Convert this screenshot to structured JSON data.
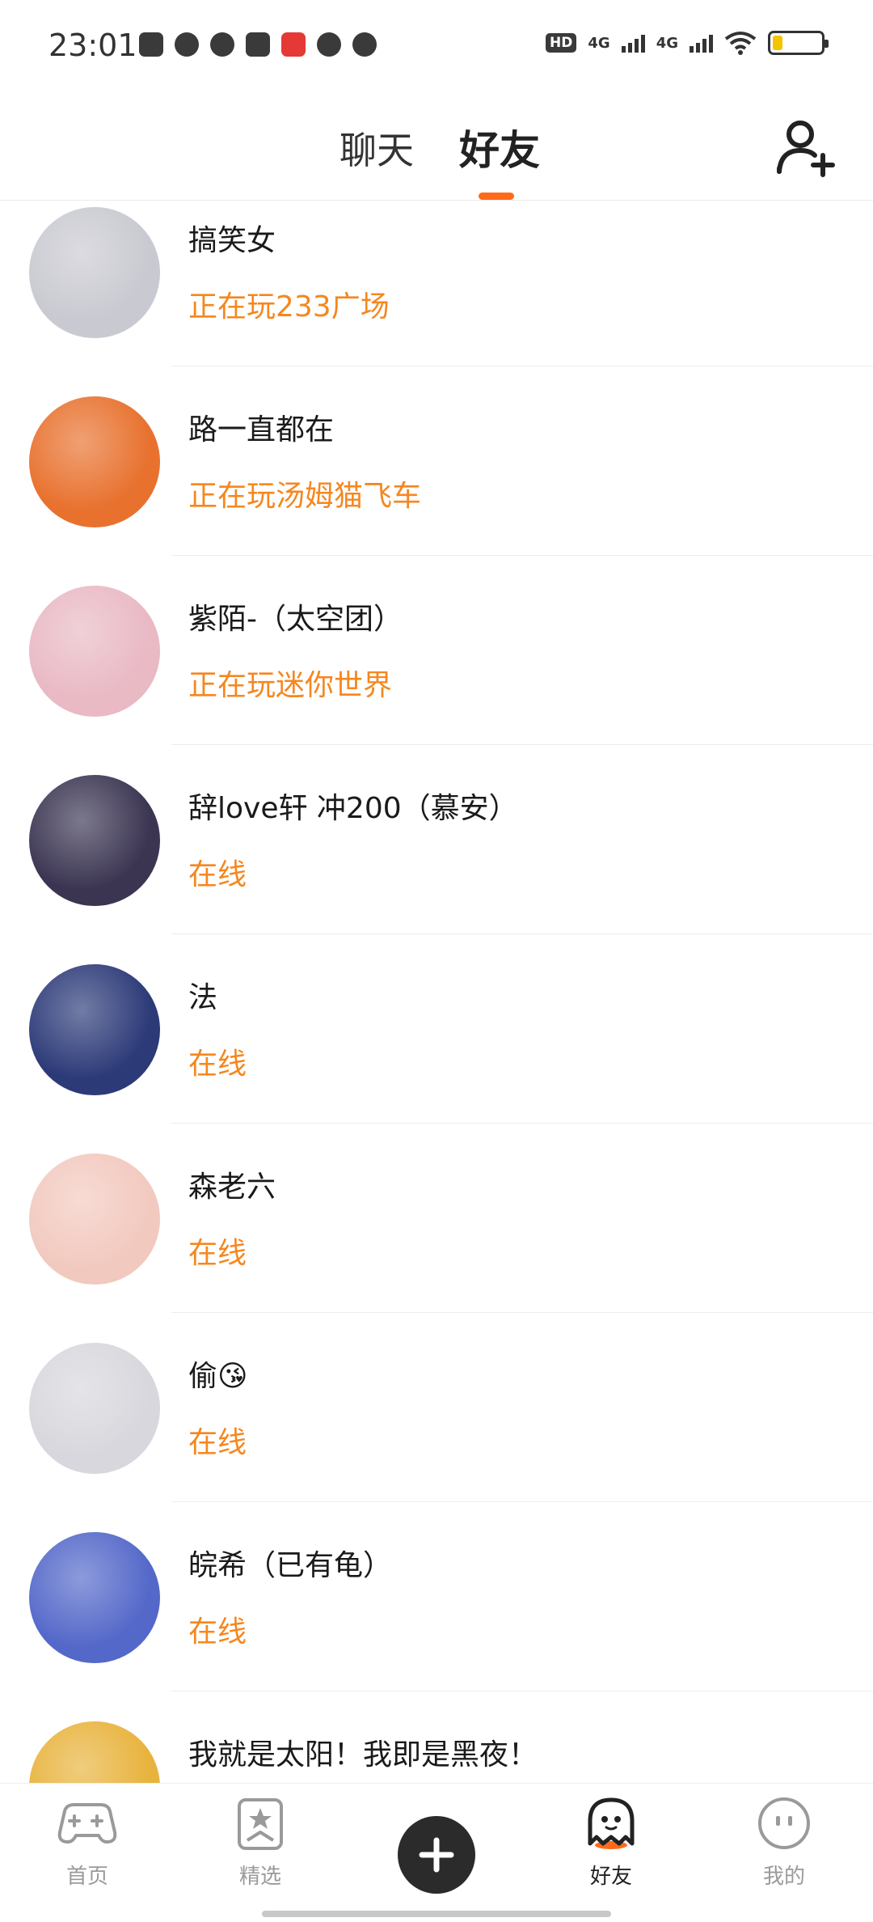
{
  "status_bar": {
    "time": "23:01",
    "hd_badge": "HD",
    "sim1_label": "4G",
    "sim2_label": "4G",
    "battery_level": 0.2,
    "battery_color": "#f5c400",
    "app_icons": [
      "scan-app-icon",
      "speed-app-icon",
      "heart-app-icon",
      "book-app-icon",
      "toutiao-app-icon",
      "tiktok-app-icon",
      "ghost-app-icon"
    ]
  },
  "header": {
    "tabs": [
      {
        "label": "聊天",
        "active": false
      },
      {
        "label": "好友",
        "active": true
      }
    ],
    "accent_color": "#ff6a1a",
    "add_friend_icon": "add-user-icon"
  },
  "friends": [
    {
      "name": "搞笑女",
      "status": "正在玩233广场",
      "avatar_color": "#c9c9d1"
    },
    {
      "name": "路一直都在",
      "status": "正在玩汤姆猫飞车",
      "avatar_color": "#e8712e"
    },
    {
      "name": "紫陌-（太空团）",
      "status": "正在玩迷你世界",
      "avatar_color": "#e9b9c4"
    },
    {
      "name": "辞love轩  冲200（慕安）",
      "status": "在线",
      "avatar_color": "#3b3552"
    },
    {
      "name": "法",
      "status": "在线",
      "avatar_color": "#2c3a78"
    },
    {
      "name": "森老六",
      "status": "在线",
      "avatar_color": "#f2c9bf"
    },
    {
      "name": "偷😘",
      "status": "在线",
      "avatar_color": "#d7d7dd"
    },
    {
      "name": "皖希（已有龟）",
      "status": "在线",
      "avatar_color": "#5468c9"
    },
    {
      "name": "我就是太阳！我即是黑夜！",
      "status": "",
      "avatar_color": "#e8b33d"
    }
  ],
  "status_color": "#f5871f",
  "bottom_nav": {
    "items": [
      {
        "label": "首页",
        "icon": "gamepad-icon",
        "active": false
      },
      {
        "label": "精选",
        "icon": "bookmark-star-icon",
        "active": false
      },
      {
        "label": "好友",
        "icon": "ghost-icon",
        "active": true
      },
      {
        "label": "我的",
        "icon": "face-icon",
        "active": false
      }
    ],
    "center_icon": "plus-icon"
  }
}
